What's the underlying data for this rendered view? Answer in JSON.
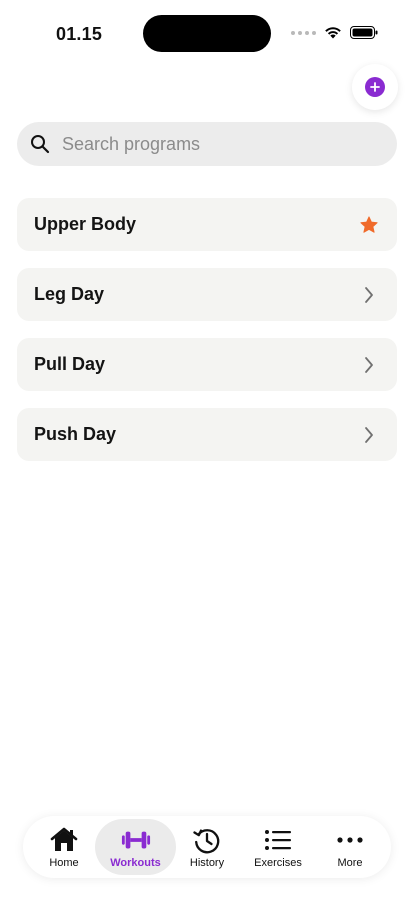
{
  "status_bar": {
    "time": "01.15"
  },
  "colors": {
    "accent": "#8a2bd1",
    "star": "#f06a2a",
    "chevron": "#707070"
  },
  "header": {
    "add_button_icon": "plus-circle-icon"
  },
  "search": {
    "placeholder": "Search programs",
    "value": ""
  },
  "programs": [
    {
      "name": "Upper Body",
      "trailing_icon": "star-icon"
    },
    {
      "name": "Leg Day",
      "trailing_icon": "chevron-right-icon"
    },
    {
      "name": "Pull Day",
      "trailing_icon": "chevron-right-icon"
    },
    {
      "name": "Push Day",
      "trailing_icon": "chevron-right-icon"
    }
  ],
  "tab_bar": {
    "active": "Workouts",
    "tabs": [
      {
        "label": "Home",
        "icon": "home-icon"
      },
      {
        "label": "Workouts",
        "icon": "dumbbell-icon"
      },
      {
        "label": "History",
        "icon": "history-icon"
      },
      {
        "label": "Exercises",
        "icon": "list-icon"
      },
      {
        "label": "More",
        "icon": "more-dots-icon"
      }
    ]
  }
}
